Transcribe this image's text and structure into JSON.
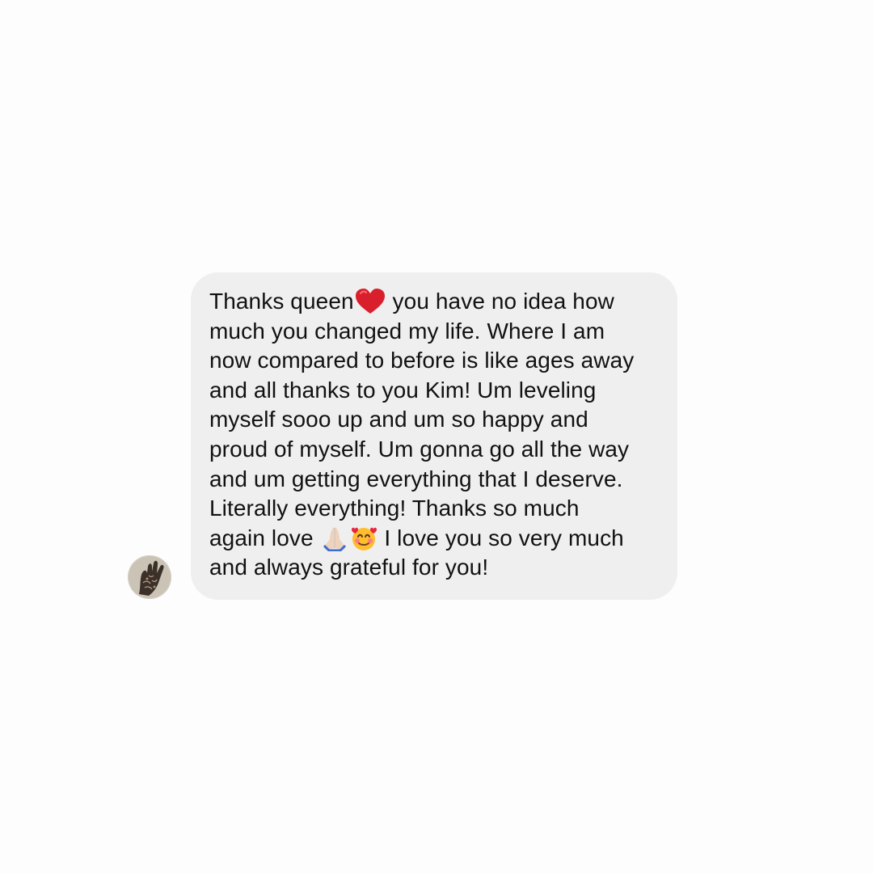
{
  "message": {
    "lines": [
      {
        "before": "Thanks queen",
        "after": " you have no idea how"
      },
      "much you changed my life. Where I am",
      "now compared to before is like ages away",
      "and all thanks to you Kim! Um leveling",
      "myself sooo up and um so happy and",
      "proud of myself. Um gonna go all the way",
      "and um getting everything that I deserve.",
      "Literally everything! Thanks so much",
      {
        "before": "again love ",
        "after": " I love you so very much"
      },
      "and always grateful for you!"
    ],
    "emojis": [
      "red-heart-emoji",
      "folded-hands-emoji",
      "smiling-face-with-hearts-emoji"
    ],
    "bubble_color": "#efefef",
    "text_color": "#111111"
  },
  "sender": {
    "avatar_icon": "henna-hand-avatar"
  }
}
